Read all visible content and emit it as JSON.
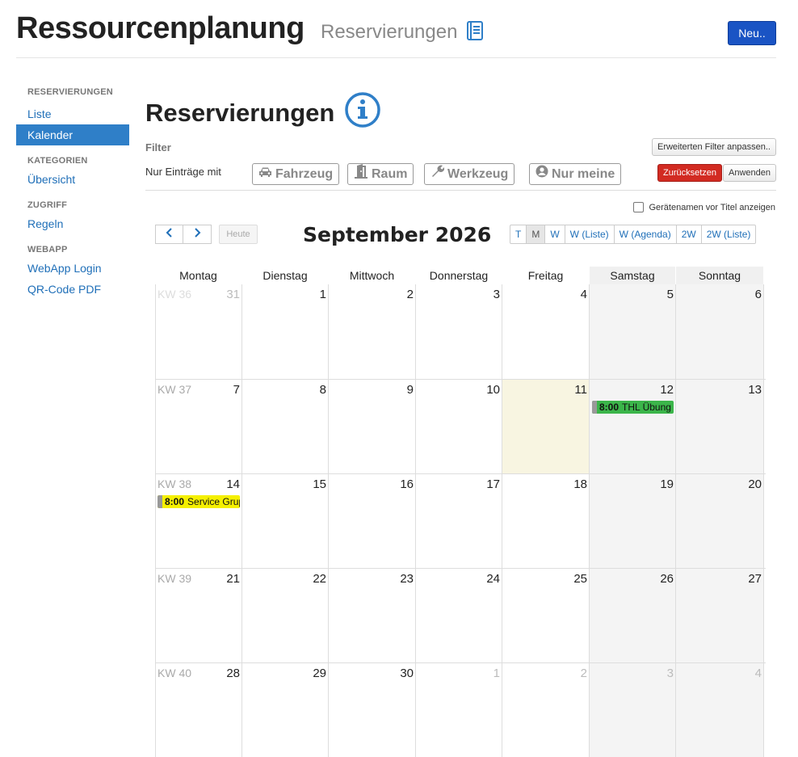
{
  "header": {
    "title": "Ressourcenplanung",
    "subtitle": "Reservierungen",
    "new_button": "Neu.."
  },
  "sidebar": {
    "sections": [
      {
        "heading": "RESERVIERUNGEN",
        "items": [
          {
            "label": "Liste",
            "active": false
          },
          {
            "label": "Kalender",
            "active": true
          }
        ]
      },
      {
        "heading": "KATEGORIEN",
        "items": [
          {
            "label": "Übersicht",
            "active": false
          }
        ]
      },
      {
        "heading": "ZUGRIFF",
        "items": [
          {
            "label": "Regeln",
            "active": false
          }
        ]
      },
      {
        "heading": "WEBAPP",
        "items": [
          {
            "label": "WebApp Login",
            "active": false
          },
          {
            "label": "QR-Code PDF",
            "active": false
          }
        ]
      }
    ]
  },
  "main": {
    "title": "Reservierungen",
    "filter_label": "Filter",
    "ext_filter_button": "Erweiterten Filter anpassen..",
    "filter_text": "Nur Einträge mit",
    "filter_buttons": [
      {
        "label": "Fahrzeug",
        "icon": "car-icon"
      },
      {
        "label": "Raum",
        "icon": "door-icon"
      },
      {
        "label": "Werkzeug",
        "icon": "wrench-icon"
      },
      {
        "label": "Nur meine",
        "icon": "user-icon"
      }
    ],
    "reset_button": "Zurücksetzen",
    "apply_button": "Anwenden",
    "checkbox_label": "Gerätenamen vor Titel anzeigen",
    "checkbox_checked": false
  },
  "calendar": {
    "title": "September 2026",
    "today_button": "Heute",
    "views": [
      {
        "label": "T",
        "active": false
      },
      {
        "label": "M",
        "active": true
      },
      {
        "label": "W",
        "active": false
      },
      {
        "label": "W (Liste)",
        "active": false
      },
      {
        "label": "W (Agenda)",
        "active": false
      },
      {
        "label": "2W",
        "active": false
      },
      {
        "label": "2W (Liste)",
        "active": false
      }
    ],
    "weekdays": [
      "Montag",
      "Dienstag",
      "Mittwoch",
      "Donnerstag",
      "Freitag",
      "Samstag",
      "Sonntag"
    ],
    "weeks": [
      {
        "kw": "KW 36",
        "kw_other": true,
        "days": [
          {
            "d": "31",
            "other": true
          },
          {
            "d": "1"
          },
          {
            "d": "2"
          },
          {
            "d": "3"
          },
          {
            "d": "4"
          },
          {
            "d": "5"
          },
          {
            "d": "6"
          }
        ]
      },
      {
        "kw": "KW 37",
        "days": [
          {
            "d": "7"
          },
          {
            "d": "8"
          },
          {
            "d": "9"
          },
          {
            "d": "10"
          },
          {
            "d": "11",
            "today": true
          },
          {
            "d": "12",
            "event": {
              "time": "8:00",
              "title": "THL Übung",
              "color": "#3bb54a"
            }
          },
          {
            "d": "13"
          }
        ]
      },
      {
        "kw": "KW 38",
        "days": [
          {
            "d": "14",
            "event": {
              "time": "8:00",
              "title": "Service Gruppe",
              "color": "#f5f000"
            }
          },
          {
            "d": "15"
          },
          {
            "d": "16"
          },
          {
            "d": "17"
          },
          {
            "d": "18"
          },
          {
            "d": "19"
          },
          {
            "d": "20"
          }
        ]
      },
      {
        "kw": "KW 39",
        "days": [
          {
            "d": "21"
          },
          {
            "d": "22"
          },
          {
            "d": "23"
          },
          {
            "d": "24"
          },
          {
            "d": "25"
          },
          {
            "d": "26"
          },
          {
            "d": "27"
          }
        ]
      },
      {
        "kw": "KW 40",
        "days": [
          {
            "d": "28"
          },
          {
            "d": "29"
          },
          {
            "d": "30"
          },
          {
            "d": "1",
            "other": true
          },
          {
            "d": "2",
            "other": true
          },
          {
            "d": "3",
            "other": true
          },
          {
            "d": "4",
            "other": true
          }
        ]
      }
    ]
  }
}
